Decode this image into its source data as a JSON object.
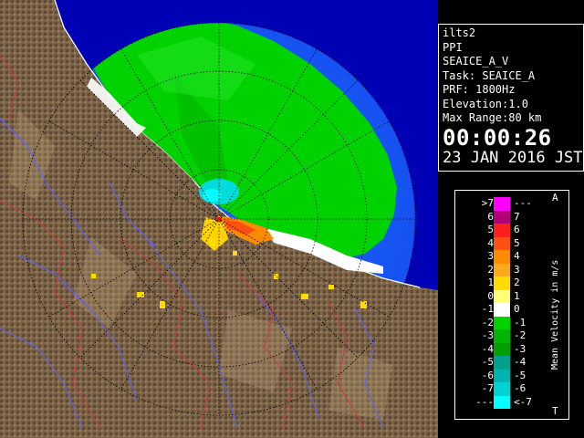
{
  "info": {
    "radar_name": "ilts2",
    "scan_type": "PPI",
    "product": "SEAICE_A_V",
    "task": "Task: SEAICE_A",
    "prf": "PRF: 1800Hz",
    "elevation": "Elevation:1.0",
    "max_range": "Max Range:80 km",
    "time": "00:00:26",
    "date": "23 JAN 2016 JST"
  },
  "legend": {
    "title": "Mean Velocity in m/s",
    "top_marker": "A",
    "bottom_marker": "T",
    "rows": [
      {
        "left": ">7",
        "right": "---",
        "color": "#ff00ff"
      },
      {
        "left": "6",
        "right": "7",
        "color": "#b40078"
      },
      {
        "left": "5",
        "right": "6",
        "color": "#ff1e1e"
      },
      {
        "left": "4",
        "right": "5",
        "color": "#ff5014"
      },
      {
        "left": "3",
        "right": "4",
        "color": "#ff8c00"
      },
      {
        "left": "2",
        "right": "3",
        "color": "#ffaa1e"
      },
      {
        "left": "1",
        "right": "2",
        "color": "#ffdc00"
      },
      {
        "left": "0",
        "right": "1",
        "color": "#ffff78"
      },
      {
        "left": "-1",
        "right": "0",
        "color": "#ffffff"
      },
      {
        "left": "-2",
        "right": "-1",
        "color": "#00d200"
      },
      {
        "left": "-3",
        "right": "-2",
        "color": "#00b400"
      },
      {
        "left": "-4",
        "right": "-3",
        "color": "#00a000"
      },
      {
        "left": "-5",
        "right": "-4",
        "color": "#00a08c"
      },
      {
        "left": "-6",
        "right": "-5",
        "color": "#00b4b4"
      },
      {
        "left": "-7",
        "right": "-6",
        "color": "#00d2d2"
      },
      {
        "left": "---",
        "right": "<-7",
        "color": "#00ffff"
      }
    ]
  },
  "colors": {
    "ocean_far": "#1e5aff",
    "ocean_near": "#0a3cd2",
    "beyond_range": "#0000b4",
    "land": "#7d6446",
    "land_dark": "#4b3c2d",
    "river": "#5a64ff",
    "boundary": "#c83c3c",
    "echo_green": "#00d200",
    "echo_yellow": "#ffd200",
    "echo_white": "#ffffff",
    "echo_cyan": "#00dcdc"
  }
}
